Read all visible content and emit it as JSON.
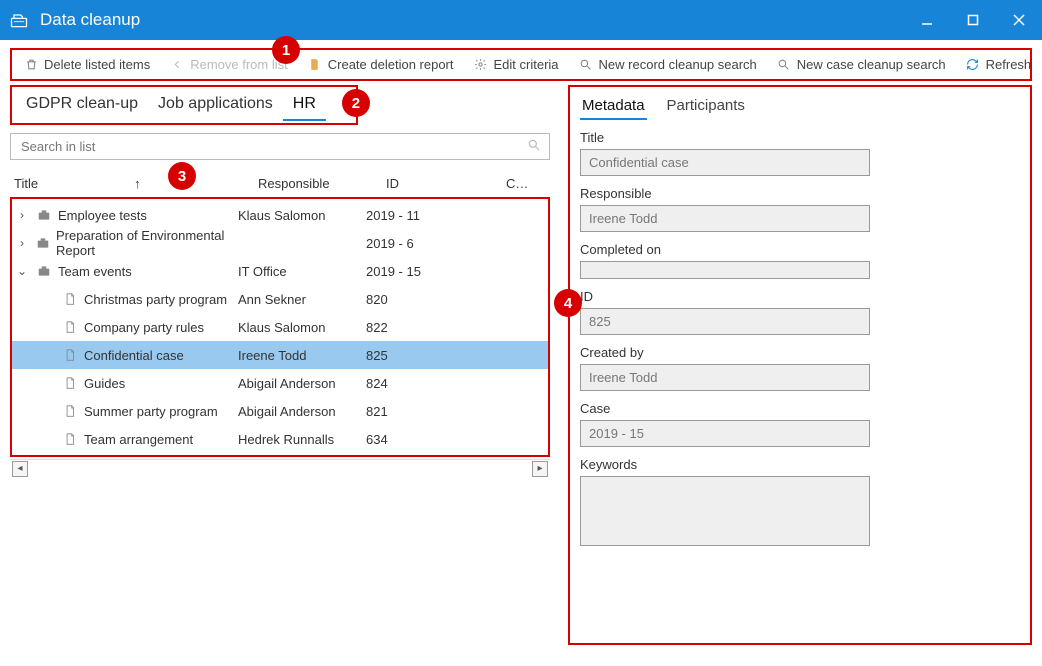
{
  "window": {
    "title": "Data cleanup"
  },
  "toolbar": {
    "delete": "Delete listed items",
    "remove": "Remove from list",
    "report": "Create deletion report",
    "edit": "Edit criteria",
    "newrecord": "New record cleanup search",
    "newcase": "New case cleanup search",
    "refresh": "Refresh"
  },
  "badges": {
    "b1": "1",
    "b2": "2",
    "b3": "3",
    "b4": "4"
  },
  "leftTabs": {
    "t0": "GDPR clean-up",
    "t1": "Job applications",
    "t2": "HR"
  },
  "search": {
    "placeholder": "Search in list"
  },
  "columns": {
    "title": "Title",
    "responsible": "Responsible",
    "id": "ID",
    "last": "C…"
  },
  "rows": [
    {
      "chev": "›",
      "depth": 0,
      "kind": "case",
      "title": "Employee tests",
      "responsible": "Klaus Salomon",
      "id": "2019 - 11"
    },
    {
      "chev": "›",
      "depth": 0,
      "kind": "case",
      "title": "Preparation of Environmental Report",
      "responsible": "",
      "id": "2019 - 6"
    },
    {
      "chev": "⌄",
      "depth": 0,
      "kind": "case",
      "title": "Team events",
      "responsible": "IT Office",
      "id": "2019 - 15"
    },
    {
      "chev": "",
      "depth": 1,
      "kind": "doc",
      "title": "Christmas party program",
      "responsible": "Ann Sekner",
      "id": "820"
    },
    {
      "chev": "",
      "depth": 1,
      "kind": "doc",
      "title": "Company party rules",
      "responsible": "Klaus Salomon",
      "id": "822"
    },
    {
      "chev": "",
      "depth": 1,
      "kind": "doc",
      "title": "Confidential case",
      "responsible": "Ireene Todd",
      "id": "825",
      "selected": true
    },
    {
      "chev": "",
      "depth": 1,
      "kind": "doc",
      "title": "Guides",
      "responsible": "Abigail Anderson",
      "id": "824"
    },
    {
      "chev": "",
      "depth": 1,
      "kind": "doc",
      "title": "Summer party program",
      "responsible": "Abigail Anderson",
      "id": "821"
    },
    {
      "chev": "",
      "depth": 1,
      "kind": "doc",
      "title": "Team arrangement",
      "responsible": "Hedrek Runnalls",
      "id": "634"
    }
  ],
  "rightTabs": {
    "metadata": "Metadata",
    "participants": "Participants"
  },
  "meta": {
    "title_label": "Title",
    "title_value": "Confidential case",
    "resp_label": "Responsible",
    "resp_value": "Ireene Todd",
    "comp_label": "Completed on",
    "comp_value": "",
    "id_label": "ID",
    "id_value": "825",
    "created_label": "Created by",
    "created_value": "Ireene Todd",
    "case_label": "Case",
    "case_value": "2019 - 15",
    "kw_label": "Keywords",
    "kw_value": ""
  }
}
